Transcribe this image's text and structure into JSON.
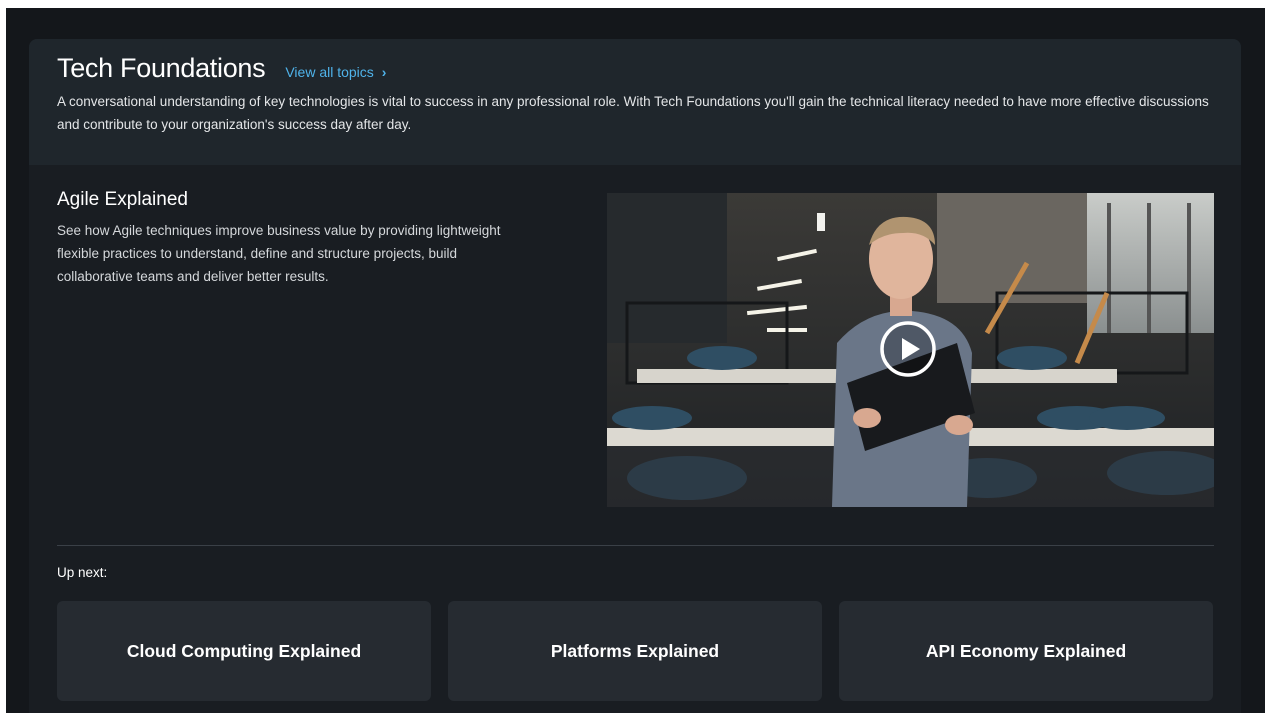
{
  "section": {
    "title": "Tech Foundations",
    "view_all_label": "View all topics",
    "view_all_icon": "chevron-right-icon",
    "description": "A conversational understanding of key technologies is vital to success in any professional role. With Tech Foundations you'll gain the technical literacy needed to have more effective discussions and contribute to your organization's success day after day."
  },
  "feature": {
    "title": "Agile Explained",
    "description": "See how Agile techniques improve business value by providing lightweight flexible practices to understand, define and structure projects, build collaborative teams and deliver better results.",
    "video_icon": "play-icon"
  },
  "up_next": {
    "label": "Up next:",
    "items": [
      {
        "title": "Cloud Computing Explained"
      },
      {
        "title": "Platforms Explained"
      },
      {
        "title": "API Economy Explained"
      }
    ]
  },
  "colors": {
    "page_bg": "#14171b",
    "panel_bg": "#191d22",
    "header_bg": "#1f262c",
    "card_bg": "#262b31",
    "link": "#4fb3ea"
  }
}
